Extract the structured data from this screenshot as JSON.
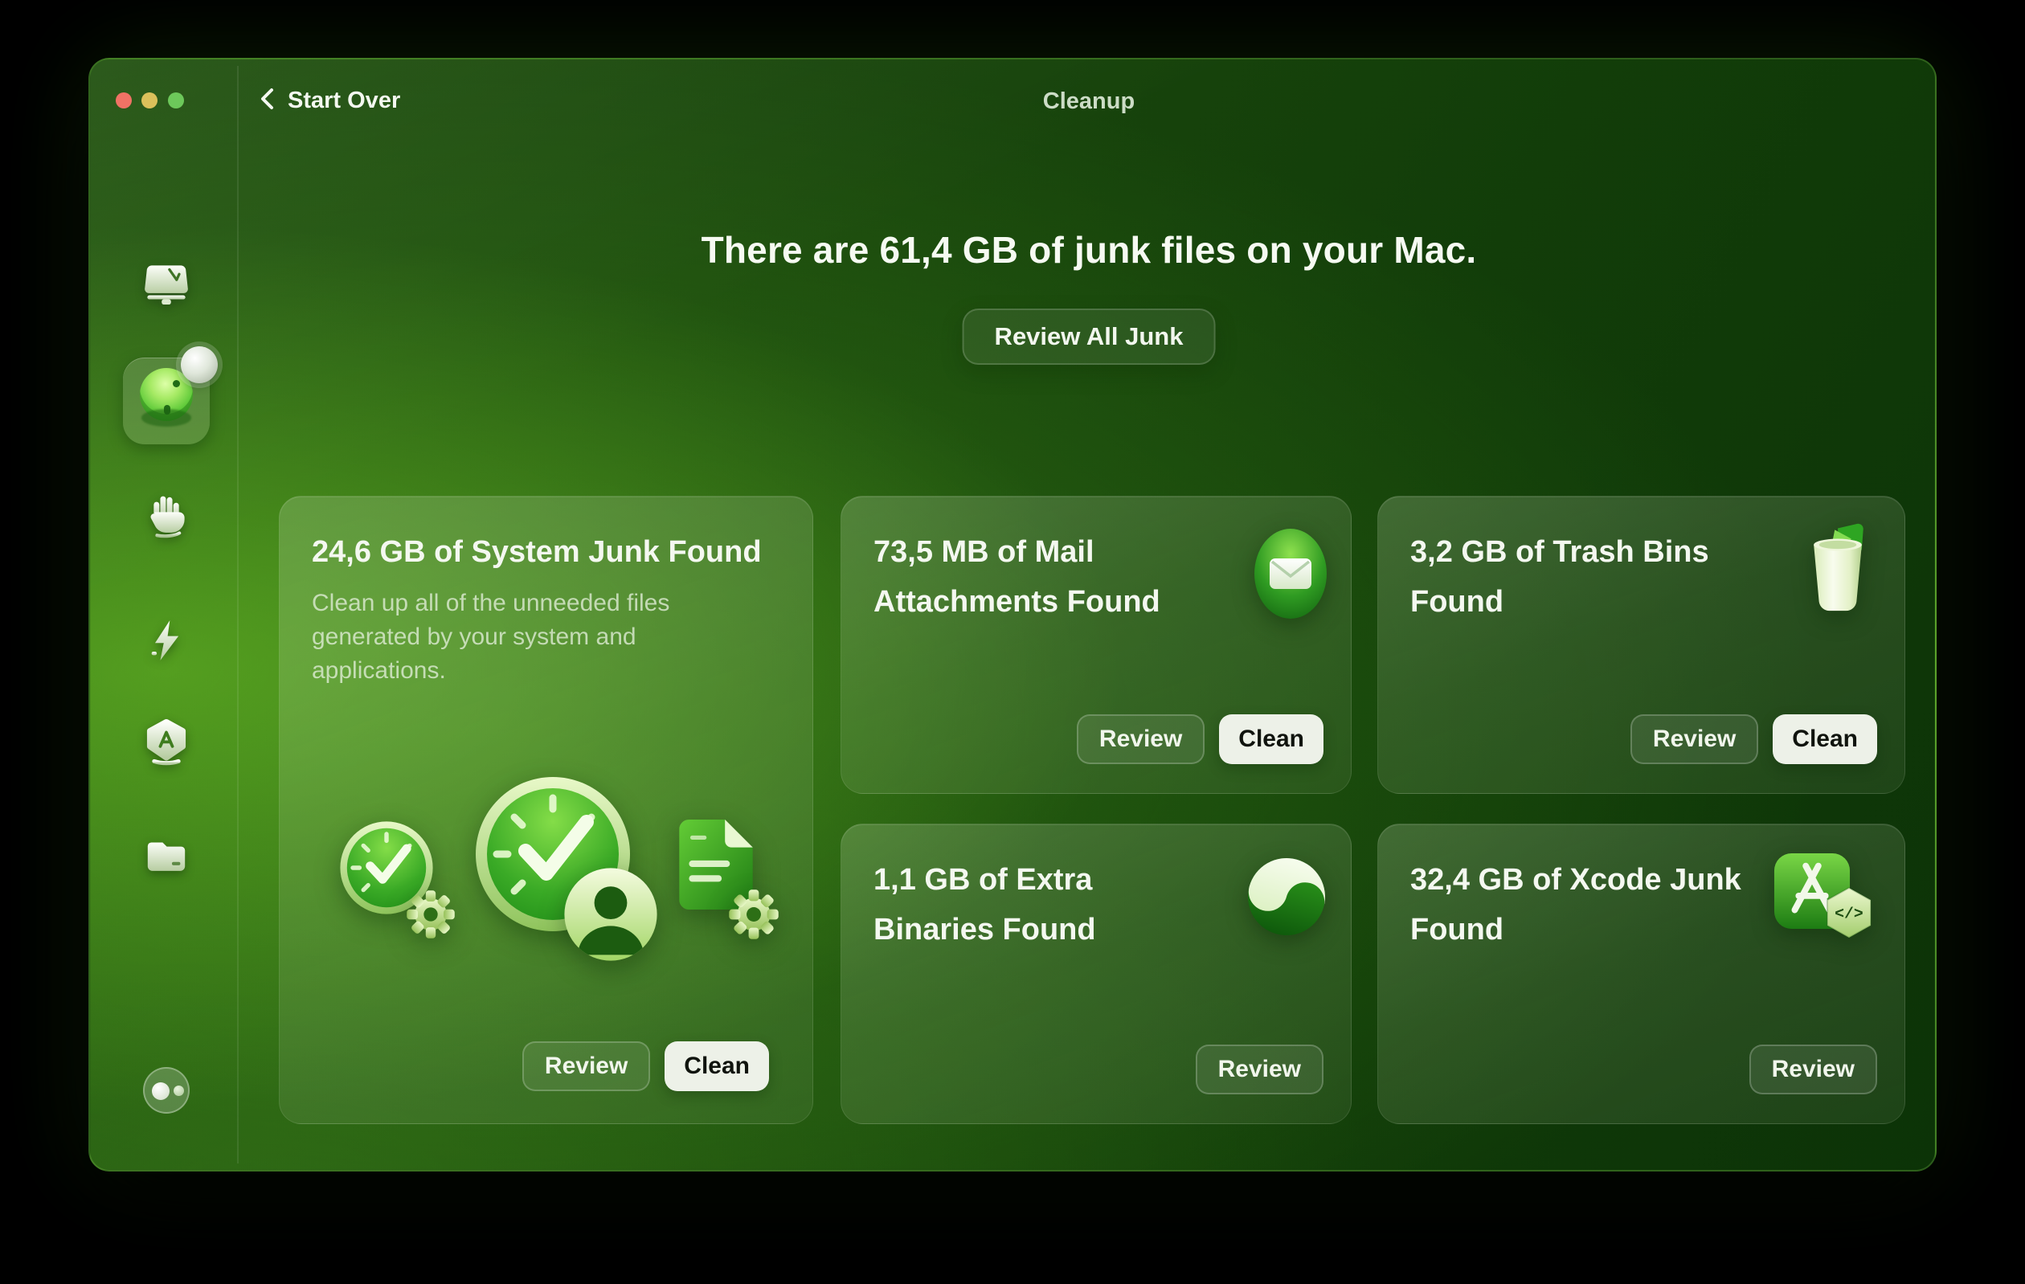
{
  "app": {
    "back_label": "Start Over",
    "title": "Cleanup"
  },
  "colors": {
    "traffic_red": "#ef6b5e",
    "traffic_yellow": "#d9bd53",
    "traffic_green": "#66c653",
    "window_green_dark": "#0c3307",
    "window_green_bright": "#3f8e1d",
    "clean_button_bg": "#edf1e8",
    "clean_button_text": "#10140e"
  },
  "sidebar": {
    "items": [
      {
        "icon": "mac-disk-icon",
        "selected": false
      },
      {
        "icon": "cleanup-orb-icon",
        "selected": true,
        "has_badge": true
      },
      {
        "icon": "hand-icon",
        "selected": false
      },
      {
        "icon": "lightning-icon",
        "selected": false
      },
      {
        "icon": "appstore-shield-icon",
        "selected": false
      },
      {
        "icon": "folder-icon",
        "selected": false
      }
    ],
    "assistant_icon": "bubbles-icon"
  },
  "main": {
    "headline": "There are 61,4 GB of junk files on your Mac.",
    "review_all_label": "Review All Junk",
    "cards": [
      {
        "id": "system-junk",
        "title": "24,6 GB of System Junk Found",
        "description": "Clean up all of the unneeded files generated by your system and applications.",
        "icons": [
          "clock-gear-icon",
          "clock-user-icon",
          "document-gear-icon"
        ],
        "review_label": "Review",
        "clean_label": "Clean"
      },
      {
        "id": "mail-attachments",
        "title": "73,5 MB of Mail Attachments Found",
        "icons": [
          "mail-envelope-icon"
        ],
        "review_label": "Review",
        "clean_label": "Clean"
      },
      {
        "id": "trash-bins",
        "title": "3,2 GB of Trash Bins Found",
        "icons": [
          "trash-bin-icon"
        ],
        "review_label": "Review",
        "clean_label": "Clean"
      },
      {
        "id": "extra-binaries",
        "title": "1,1 GB of Extra Binaries Found",
        "icons": [
          "yin-yang-icon"
        ],
        "review_label": "Review"
      },
      {
        "id": "xcode-junk",
        "title": "32,4 GB of Xcode Junk Found",
        "icons": [
          "xcode-icon"
        ],
        "review_label": "Review"
      }
    ]
  }
}
